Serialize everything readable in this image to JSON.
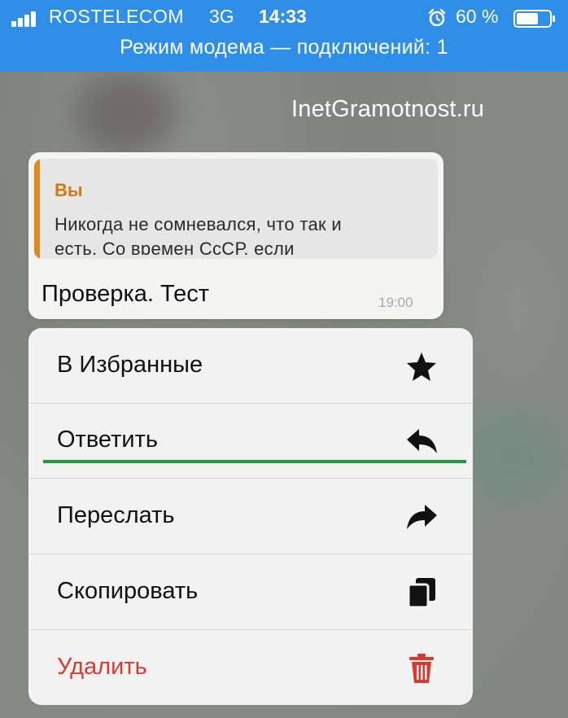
{
  "status_bar": {
    "carrier": "ROSTELECOM",
    "network": "3G",
    "time": "14:33",
    "battery_percent": "60 %",
    "hotspot_banner": "Режим модема — подключений: 1",
    "background_color": "#2e8ee8"
  },
  "watermark": "InetGramotnost.ru",
  "message": {
    "quote_author": "Вы",
    "quote_line1": "Никогда не сомневался, что так и",
    "quote_line2": "есть. Со времен СсСР, если",
    "text": "Проверка. Тест",
    "time": "19:00",
    "quote_accent_color": "#e08a1e"
  },
  "context_menu": {
    "items": [
      {
        "label": "В Избранные",
        "icon": "star-icon"
      },
      {
        "label": "Ответить",
        "icon": "reply-icon"
      },
      {
        "label": "Переслать",
        "icon": "forward-icon"
      },
      {
        "label": "Скопировать",
        "icon": "copy-icon"
      },
      {
        "label": "Удалить",
        "icon": "trash-icon",
        "color": "#d93a2f"
      }
    ],
    "highlight_color": "#1e9b3c"
  }
}
